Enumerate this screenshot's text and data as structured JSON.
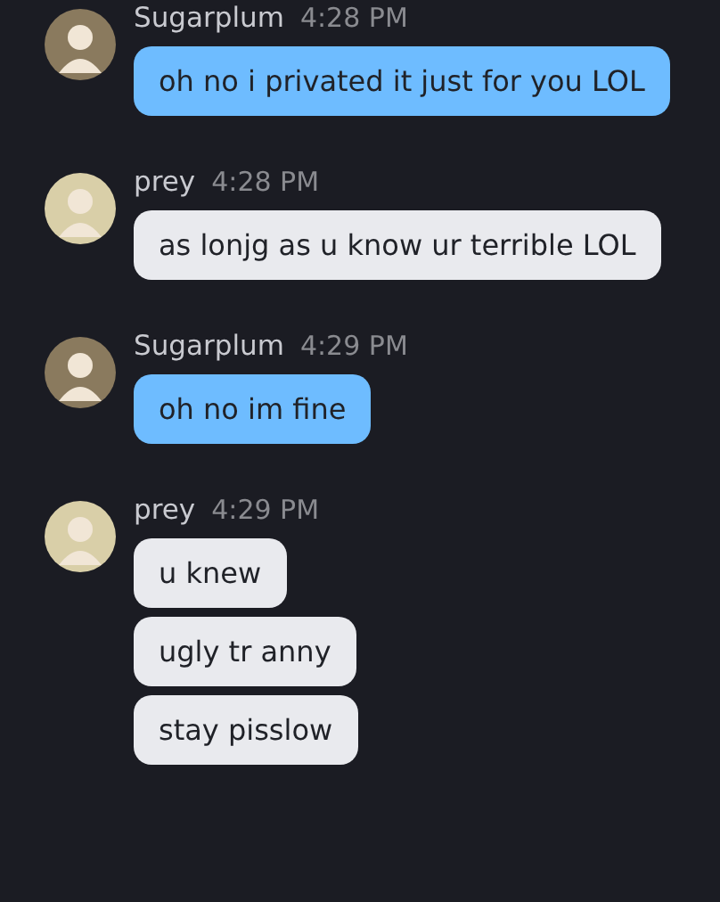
{
  "messages": [
    {
      "author": "Sugarplum",
      "time": "4:28 PM",
      "kind": "sent",
      "lines": [
        "oh no i privated it just for you LOL"
      ]
    },
    {
      "author": "prey",
      "time": "4:28 PM",
      "kind": "received",
      "lines": [
        "as lonjg as u know ur terrible LOL"
      ]
    },
    {
      "author": "Sugarplum",
      "time": "4:29 PM",
      "kind": "sent",
      "lines": [
        "oh no im fine"
      ]
    },
    {
      "author": "prey",
      "time": "4:29 PM",
      "kind": "received",
      "lines": [
        "u knew",
        "ugly tr anny",
        "stay pisslow"
      ]
    }
  ]
}
